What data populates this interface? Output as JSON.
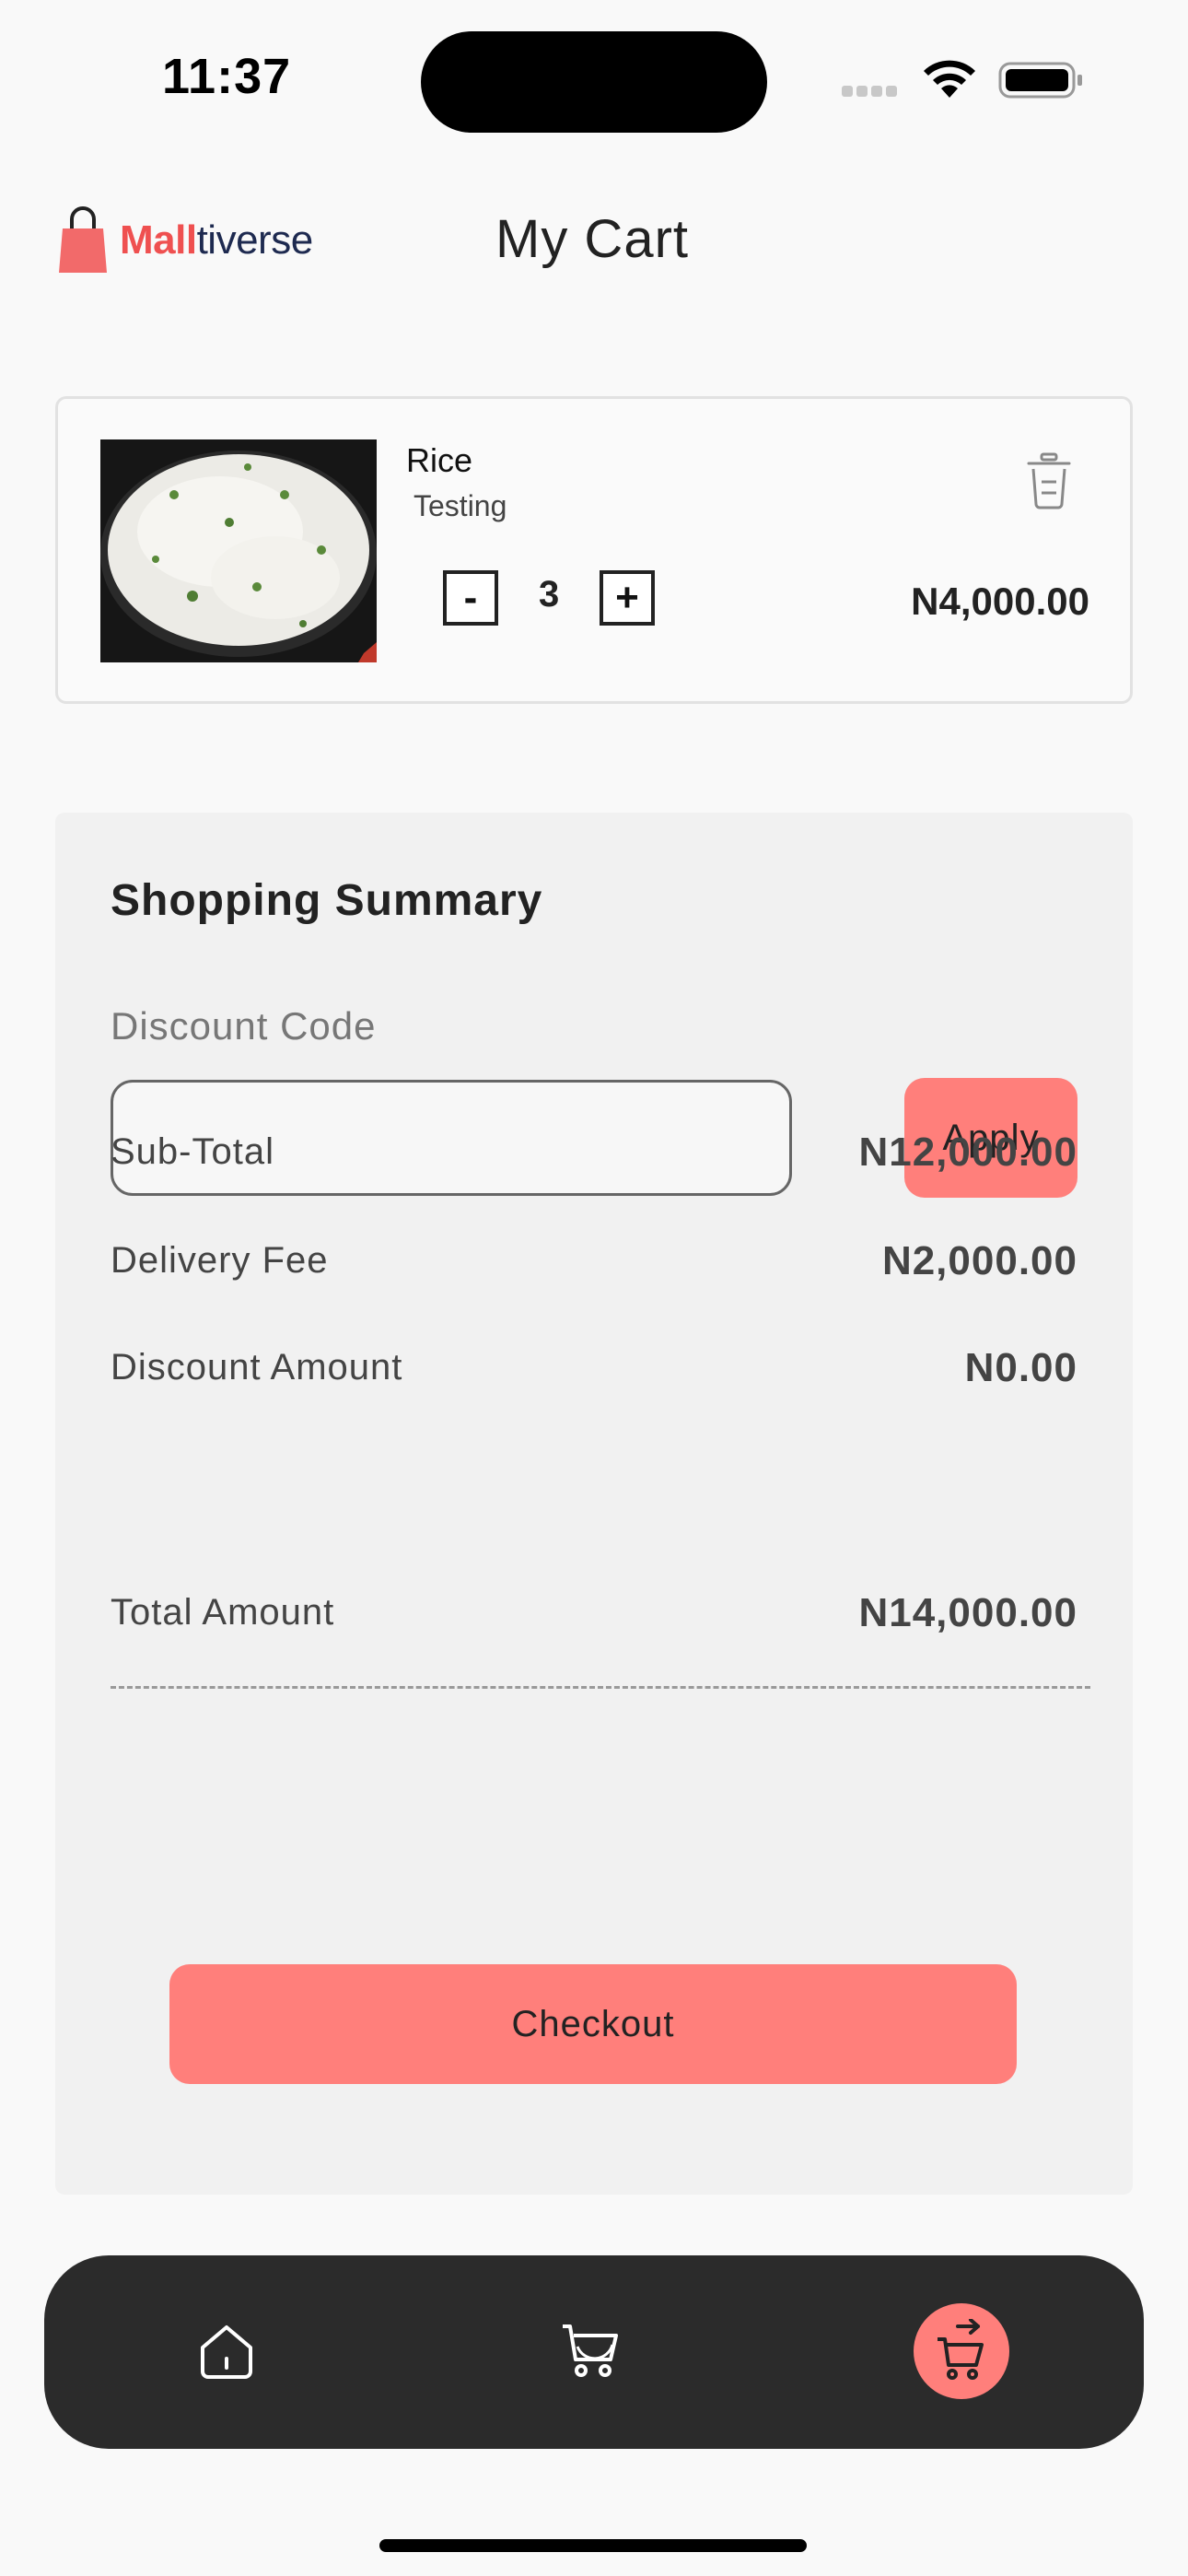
{
  "status_bar": {
    "time": "11:37"
  },
  "header": {
    "brand_accent": "Mall",
    "brand_rest": "tiverse",
    "title": "My Cart"
  },
  "cart_items": [
    {
      "name": "Rice",
      "description": "Testing",
      "quantity": "3",
      "minus_label": "-",
      "plus_label": "+",
      "price": "N4,000.00"
    }
  ],
  "summary": {
    "title": "Shopping Summary",
    "discount_label": "Discount Code",
    "discount_value": "",
    "discount_placeholder": "",
    "apply_label": "Apply",
    "rows": [
      {
        "label": "Sub-Total",
        "value": "N12,000.00"
      },
      {
        "label": "Delivery Fee",
        "value": "N2,000.00"
      },
      {
        "label": "Discount Amount",
        "value": "N0.00"
      }
    ],
    "total_label": "Total Amount",
    "total_value": "N14,000.00",
    "checkout_label": "Checkout"
  },
  "nav": {
    "items": [
      "home-icon",
      "cart-icon",
      "checkout-cart-icon"
    ],
    "active": "checkout-cart-icon"
  },
  "colors": {
    "accent": "#ff7f7b",
    "brand_red": "#ef5050",
    "nav_bg": "#2b2b2b",
    "panel_bg": "#f1f1f1"
  }
}
